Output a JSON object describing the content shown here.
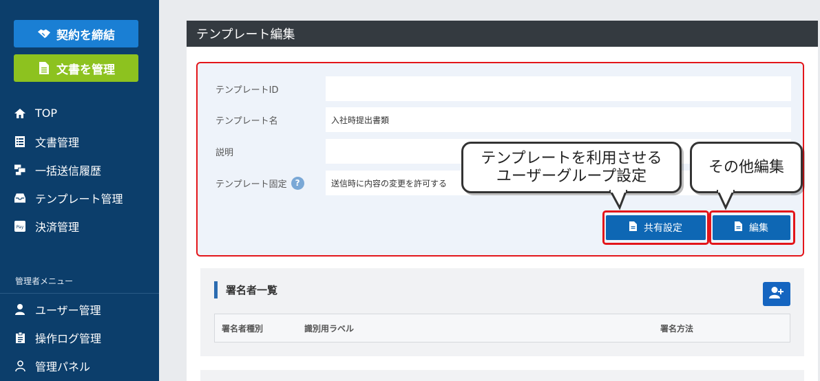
{
  "sidebar": {
    "contract_btn": "契約を締結",
    "doc_btn": "文書を管理",
    "items": [
      {
        "label": "TOP",
        "icon": "home-icon"
      },
      {
        "label": "文書管理",
        "icon": "document-list-icon"
      },
      {
        "label": "一括送信履歴",
        "icon": "bulk-send-icon"
      },
      {
        "label": "テンプレート管理",
        "icon": "inbox-icon"
      },
      {
        "label": "決済管理",
        "icon": "pay-icon"
      }
    ],
    "admin_label": "管理者メニュー",
    "admin_items": [
      {
        "label": "ユーザー管理",
        "icon": "user-icon"
      },
      {
        "label": "操作ログ管理",
        "icon": "clipboard-icon"
      },
      {
        "label": "管理パネル",
        "icon": "admin-user-icon"
      }
    ]
  },
  "panel": {
    "title": "テンプレート編集"
  },
  "form": {
    "template_id_label": "テンプレートID",
    "template_id_value": "",
    "template_name_label": "テンプレート名",
    "template_name_value": "入社時提出書類",
    "description_label": "説明",
    "description_value": "",
    "fixed_label": "テンプレート固定",
    "help_symbol": "?",
    "fixed_value": "送信時に内容の変更を許可する"
  },
  "actions": {
    "share_label": "共有設定",
    "edit_label": "編集"
  },
  "callouts": {
    "share_line1": "テンプレートを利用させる",
    "share_line2": "ユーザーグループ設定",
    "edit_text": "その他編集"
  },
  "signers": {
    "title": "署名者一覧",
    "columns": [
      "署名者種別",
      "識別用ラベル",
      "署名方法"
    ]
  },
  "colors": {
    "sidebar_bg": "#0c3e6b",
    "contract_btn": "#1a7fd4",
    "doc_btn": "#8dc21f",
    "action_btn": "#0e67b4",
    "highlight_red": "#e3151a"
  }
}
